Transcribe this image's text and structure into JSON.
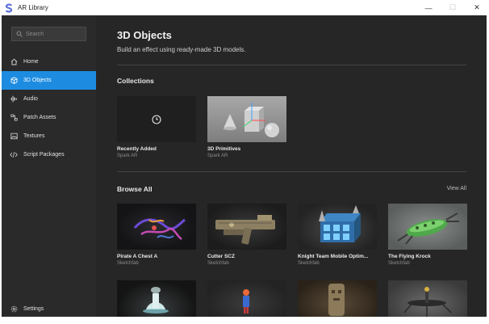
{
  "window": {
    "title": "AR Library",
    "logo_icon": "spark-ar-logo",
    "controls": [
      "minimize",
      "maximize",
      "close"
    ]
  },
  "sidebar": {
    "search_placeholder": "Search",
    "items": [
      {
        "label": "Home",
        "icon": "home-icon",
        "active": false
      },
      {
        "label": "3D Objects",
        "icon": "cube-icon",
        "active": true
      },
      {
        "label": "Audio",
        "icon": "audio-wave-icon",
        "active": false
      },
      {
        "label": "Patch Assets",
        "icon": "patch-icon",
        "active": false
      },
      {
        "label": "Textures",
        "icon": "image-icon",
        "active": false
      },
      {
        "label": "Script Packages",
        "icon": "code-icon",
        "active": false
      }
    ],
    "settings_label": "Settings",
    "accent": "#1d8ce0"
  },
  "main": {
    "title": "3D Objects",
    "subtitle": "Build an effect using ready-made 3D models.",
    "collections_title": "Collections",
    "collections": [
      {
        "title": "Recently Added",
        "source": "Spark AR"
      },
      {
        "title": "3D Primitives",
        "source": "Spark AR"
      }
    ],
    "browse_title": "Browse All",
    "view_all_label": "View All",
    "browse": [
      {
        "title": "Pirate A Chest A",
        "source": "Sketchfab"
      },
      {
        "title": "Cutter SCZ",
        "source": "Sketchfab"
      },
      {
        "title": "Knight Team Mobile Optim...",
        "source": "Sketchfab"
      },
      {
        "title": "The Flying Krock",
        "source": "Sketchfab"
      }
    ]
  }
}
